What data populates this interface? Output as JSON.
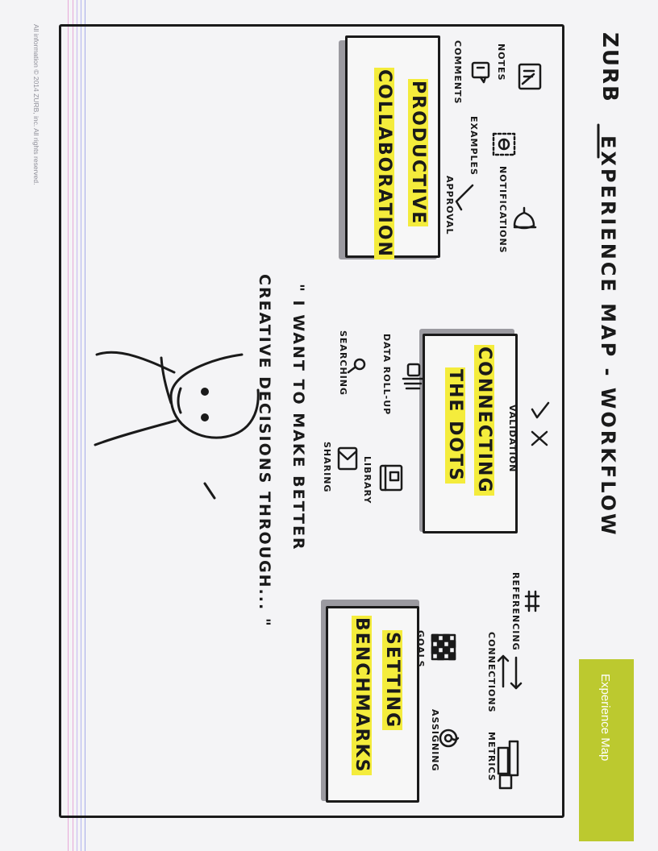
{
  "copyright": "All information © 2014 ZURB, inc. All rights reserved.",
  "logo": "ZURB",
  "title": "EXPERIENCE MAP - WORKFLOW",
  "badge": "Experience Map",
  "quote": {
    "line1": "\" I WANT TO MAKE BETTER",
    "line2": "CREATIVE DECISIONS THROUGH... \""
  },
  "boxes": {
    "collaboration": {
      "line1": "PRODUCTIVE",
      "line2": "COLLABORATION"
    },
    "dots": {
      "line1": "CONNECTING",
      "line2": "THE DOTS"
    },
    "benchmarks": {
      "line1": "SETTING",
      "line2": "BENCHMARKS"
    }
  },
  "icons": {
    "notes": "NOTES",
    "comments": "COMMENTS",
    "examples": "EXAMPLES",
    "notifications": "NOTIFICATIONS",
    "approval": "APPROVAL",
    "validation": "VALIDATION",
    "data_rollup": "DATA ROLL-UP",
    "searching": "SEARCHING",
    "library": "LIBRARY",
    "sharing": "SHARING",
    "referencing": "REFERENCING",
    "connections": "CONNECTIONS",
    "metrics": "METRICS",
    "goals": "GOALS",
    "assigning": "ASSIGNING"
  },
  "colors": {
    "highlight": "#f4ec3c",
    "badge": "#bcc92f",
    "ink": "#1a1a1a",
    "shadow": "#9b9aa0"
  }
}
